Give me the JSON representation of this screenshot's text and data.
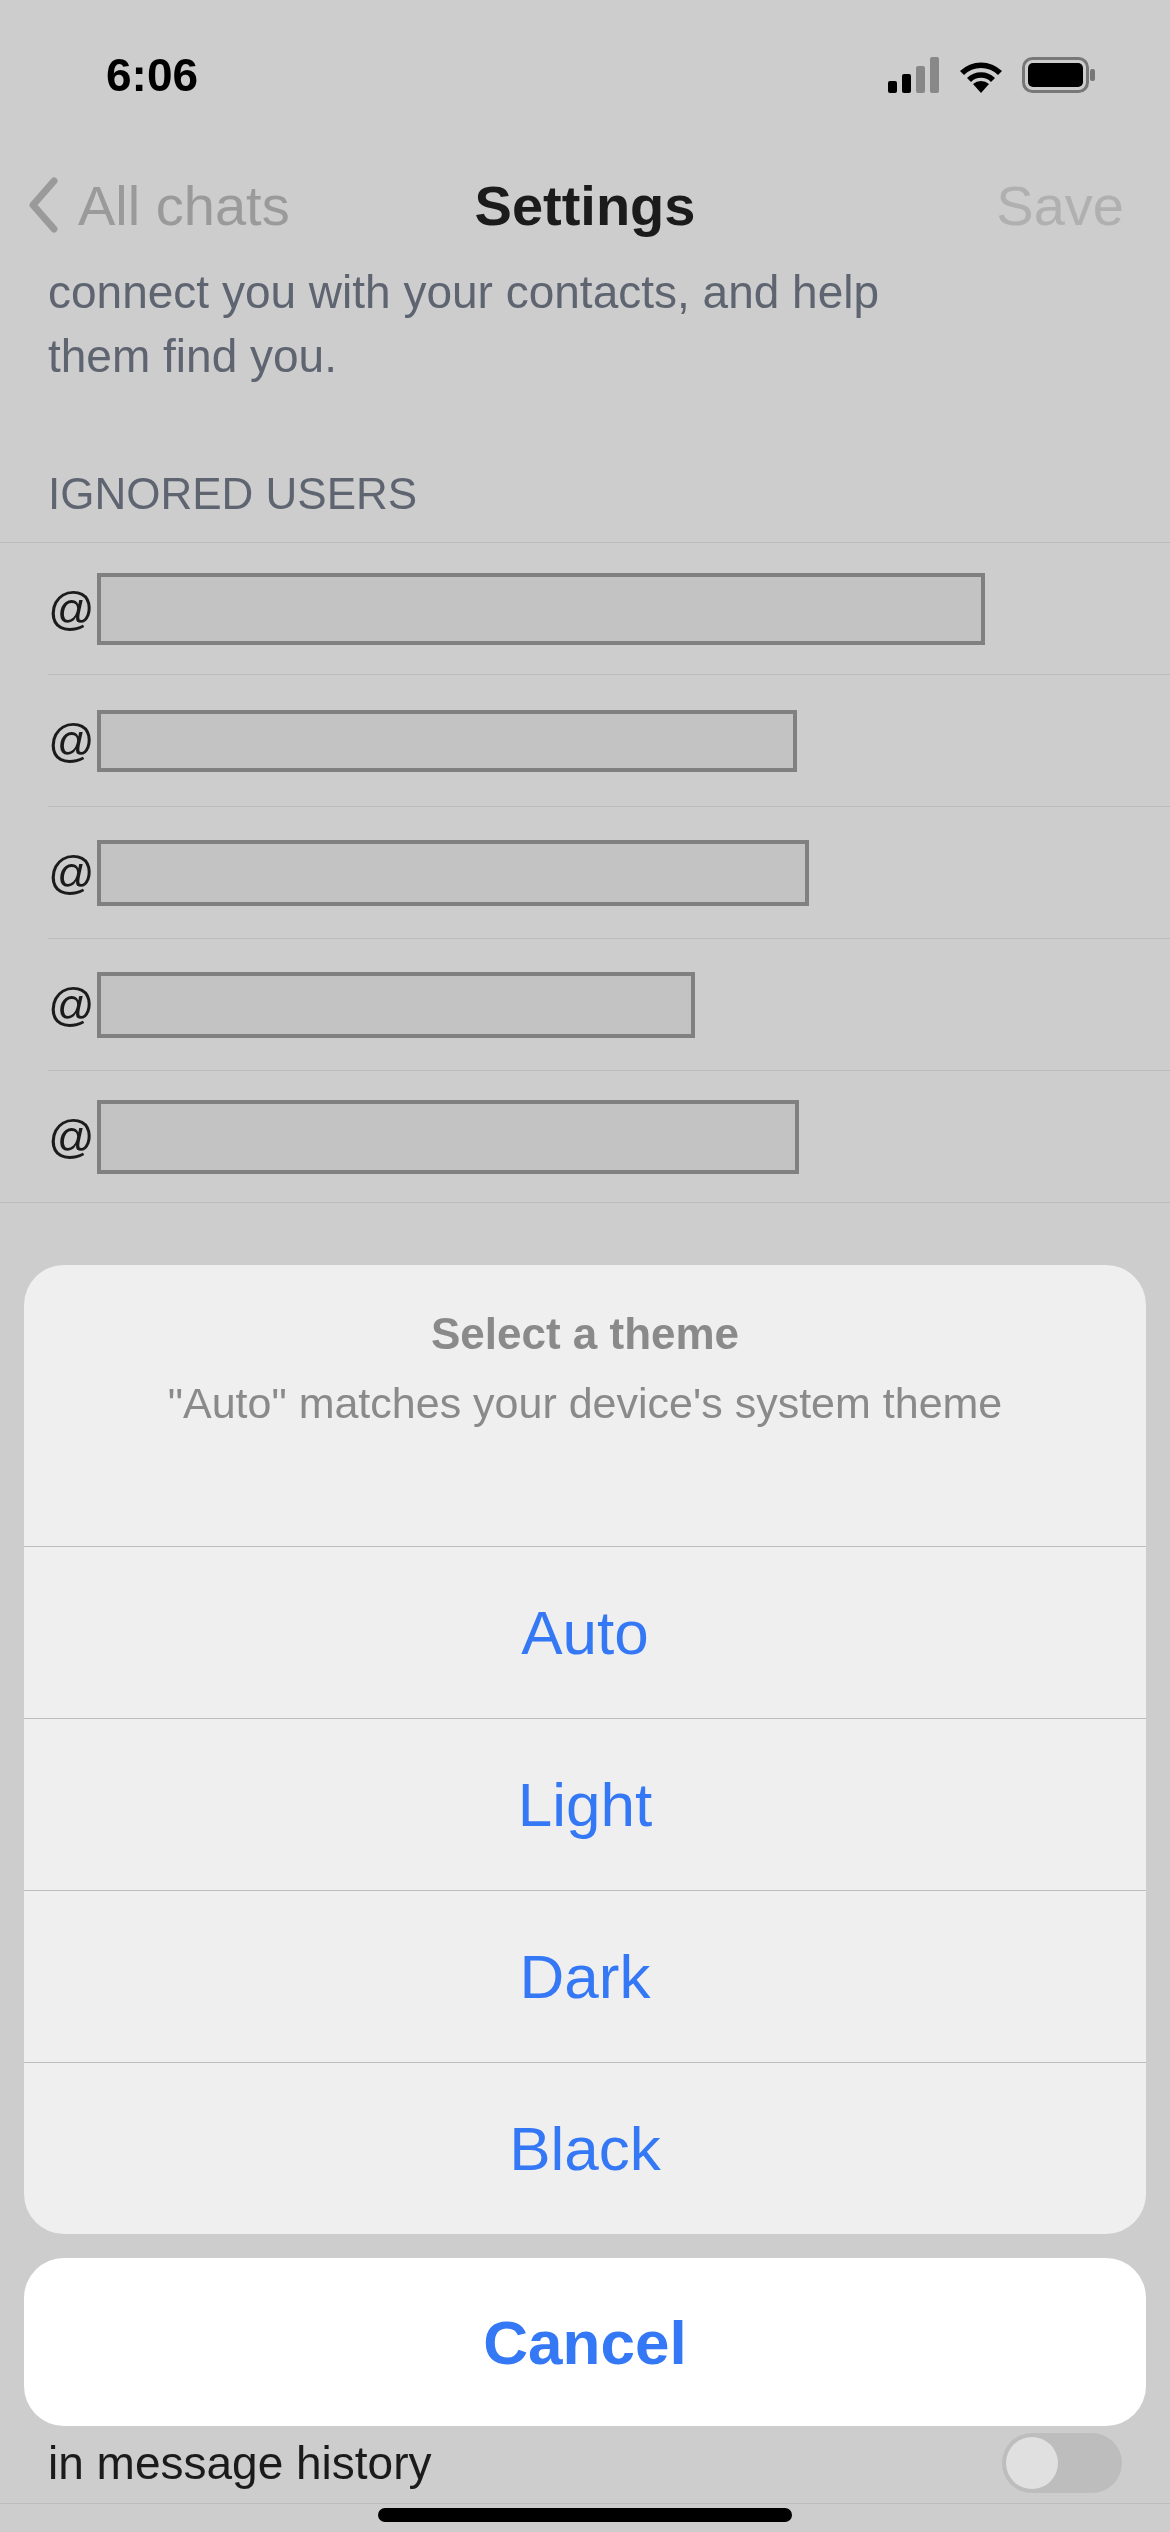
{
  "status_bar": {
    "time": "6:06"
  },
  "nav": {
    "back": "All chats",
    "title": "Settings",
    "action": "Save"
  },
  "description": [
    "connect you with your contacts, and help",
    "them find you."
  ],
  "ignored_users": {
    "header": "IGNORED USERS",
    "users": [
      {
        "prefix": "@"
      },
      {
        "prefix": "@"
      },
      {
        "prefix": "@"
      },
      {
        "prefix": "@"
      },
      {
        "prefix": "@"
      }
    ]
  },
  "background_row": {
    "label": "in message history",
    "toggle_on": false
  },
  "action_sheet": {
    "title": "Select a theme",
    "message": "\"Auto\" matches your device's system theme",
    "options": [
      "Auto",
      "Light",
      "Dark",
      "Black"
    ],
    "cancel": "Cancel"
  }
}
